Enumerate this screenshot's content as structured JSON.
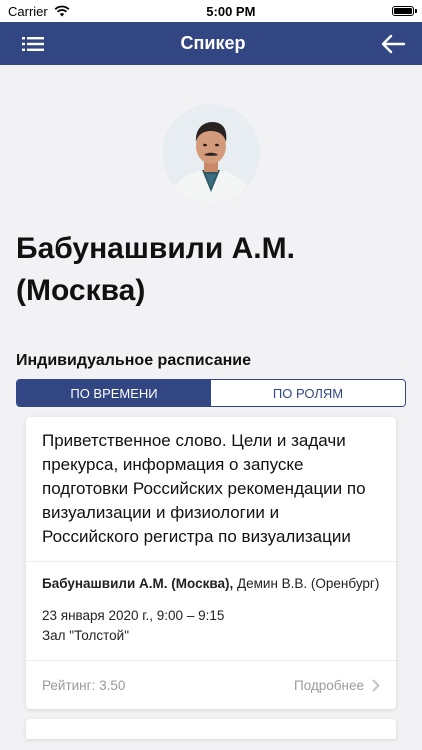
{
  "status": {
    "carrier": "Carrier",
    "time": "5:00 PM"
  },
  "nav": {
    "title": "Спикер",
    "left_icon": "list-icon",
    "right_icon": "arrow-left-icon"
  },
  "speaker": {
    "name_line1": "Бабунашвили А.М.",
    "name_line2": "(Москва)"
  },
  "schedule": {
    "title": "Индивидуальное расписание",
    "tabs": [
      "ПО ВРЕМЕНИ",
      "ПО РОЛЯМ"
    ],
    "active_tab": 0
  },
  "card": {
    "title": "Приветственное слово. Цели и задачи прекурса, информация о запуске подготовки Российских рекомендации по визуализации и физиологии и Российского регистра по визуализации",
    "speaker_bold": "Бабунашвили А.М. (Москва),",
    "speaker_rest": " Демин В.В. (Оренбург)",
    "date_time": "23 января 2020 г., 9:00 – 9:15",
    "hall": "Зал \"Толстой\"",
    "rating": "Рейтинг: 3.50",
    "more": "Подробнее"
  },
  "colors": {
    "accent": "#324684",
    "background": "#f2f2f4"
  }
}
